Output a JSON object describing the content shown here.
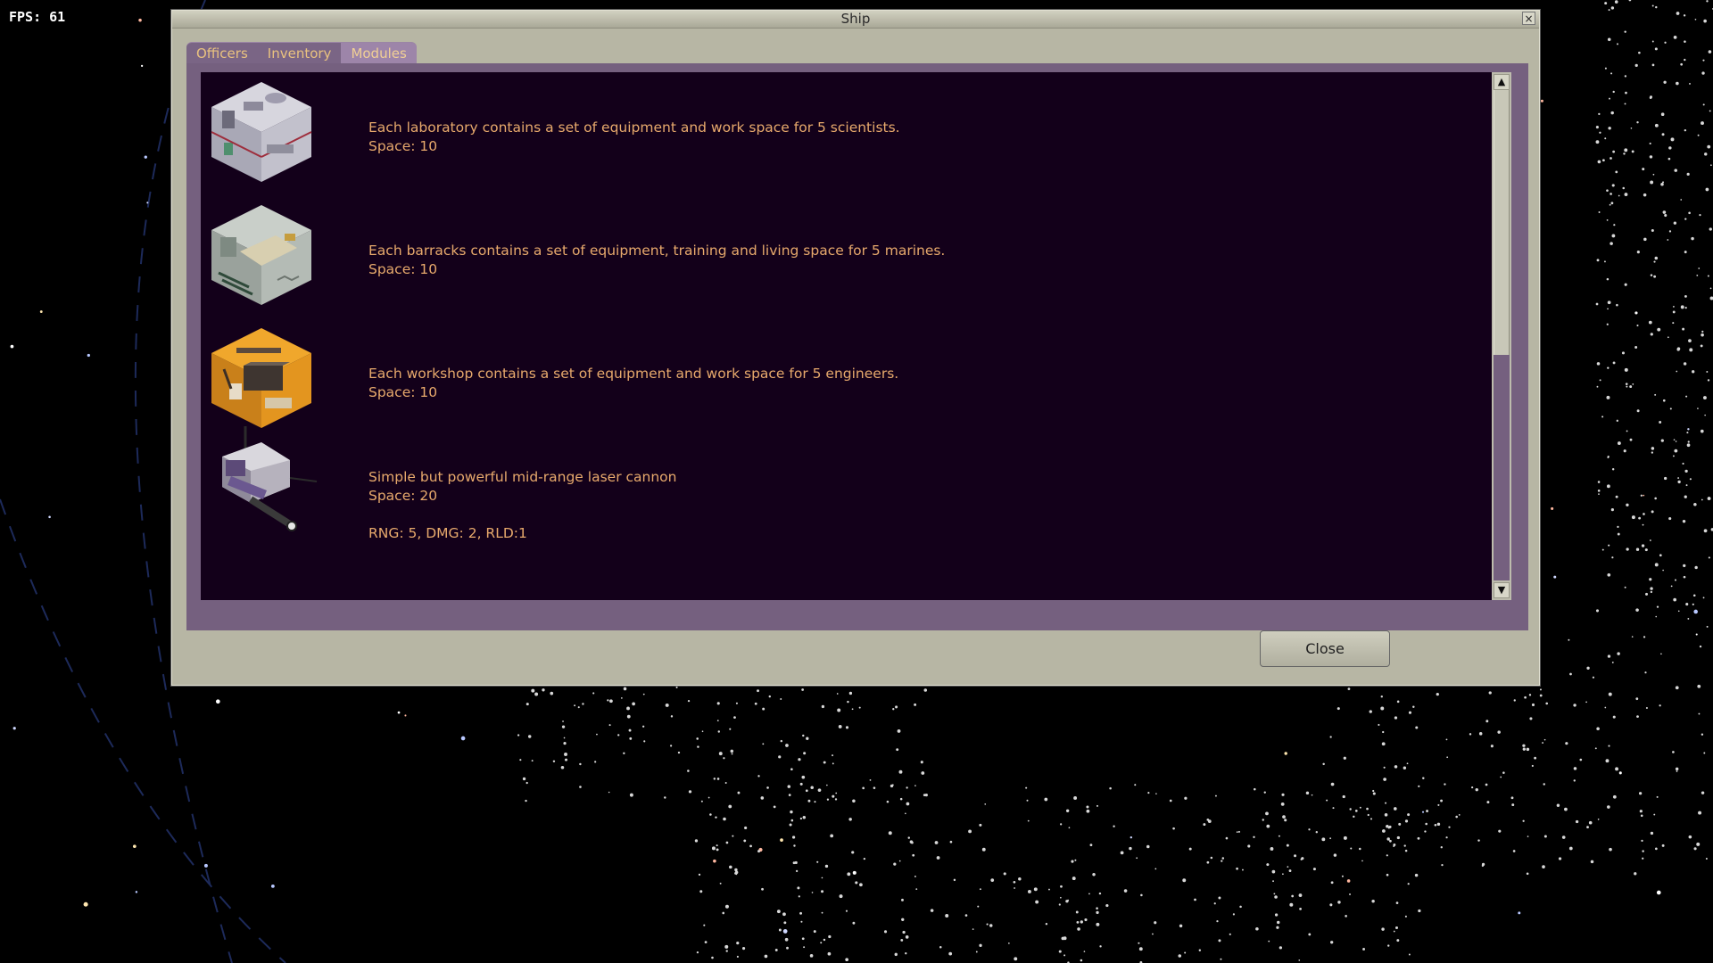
{
  "hud": {
    "fps": "FPS: 61"
  },
  "window": {
    "title": "Ship",
    "close_icon": "×",
    "tabs": [
      {
        "label": "Officers",
        "active": false
      },
      {
        "label": "Inventory",
        "active": false
      },
      {
        "label": "Modules",
        "active": true
      }
    ],
    "modules": [
      {
        "icon": "laboratory-module-icon",
        "description": "Each laboratory contains a set of equipment and work space for 5 scientists.",
        "space": "Space: 10",
        "stats": ""
      },
      {
        "icon": "barracks-module-icon",
        "description": "Each barracks contains a set of equipment, training and living space for 5 marines.",
        "space": "Space: 10",
        "stats": ""
      },
      {
        "icon": "workshop-module-icon",
        "description": "Each workshop contains a set of equipment and work space for 5 engineers.",
        "space": "Space: 10",
        "stats": ""
      },
      {
        "icon": "laser-cannon-icon",
        "description": "Simple but powerful mid-range laser cannon",
        "space": "Space: 20",
        "stats": "RNG: 5, DMG: 2, RLD:1"
      }
    ],
    "scrollbar": {
      "up_icon": "▲",
      "down_icon": "▼",
      "position": 0.0,
      "visible_fraction": 0.56
    },
    "close_button_label": "Close"
  },
  "colors": {
    "space_bg": "#000000",
    "window_bg": "#b7b6a4",
    "panel_frame": "#75607f",
    "list_bg": "#13001a",
    "text_orange": "#e7a96c",
    "tab_text": "#e9c27f"
  }
}
